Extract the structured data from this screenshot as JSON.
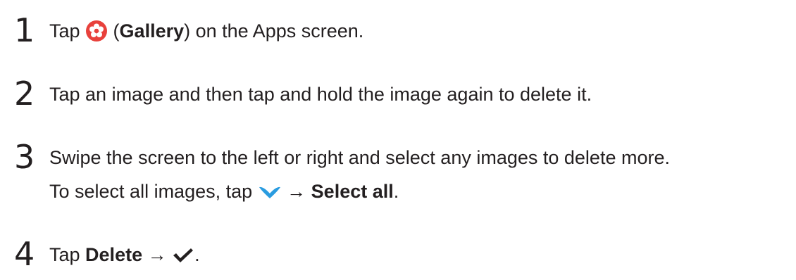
{
  "steps": [
    {
      "number": "1",
      "before": "Tap ",
      "icon": "gallery-app-icon",
      "paren_open": " (",
      "bold": "Gallery",
      "after": ") on the Apps screen."
    },
    {
      "number": "2",
      "text": "Tap an image and then tap and hold the image again to delete it."
    },
    {
      "number": "3",
      "text": "Swipe the screen to the left or right and select any images to delete more.",
      "sub": {
        "before": "To select all images, tap ",
        "icon": "chevron-down-icon",
        "arrow": " → ",
        "bold": "Select all",
        "after": "."
      }
    },
    {
      "number": "4",
      "before": "Tap ",
      "bold": "Delete",
      "arrow": " → ",
      "icon": "checkmark-icon",
      "after": "."
    }
  ],
  "colors": {
    "text": "#231f20",
    "gallery_icon": "#e8413c",
    "chevron_icon": "#2a9ce0"
  }
}
